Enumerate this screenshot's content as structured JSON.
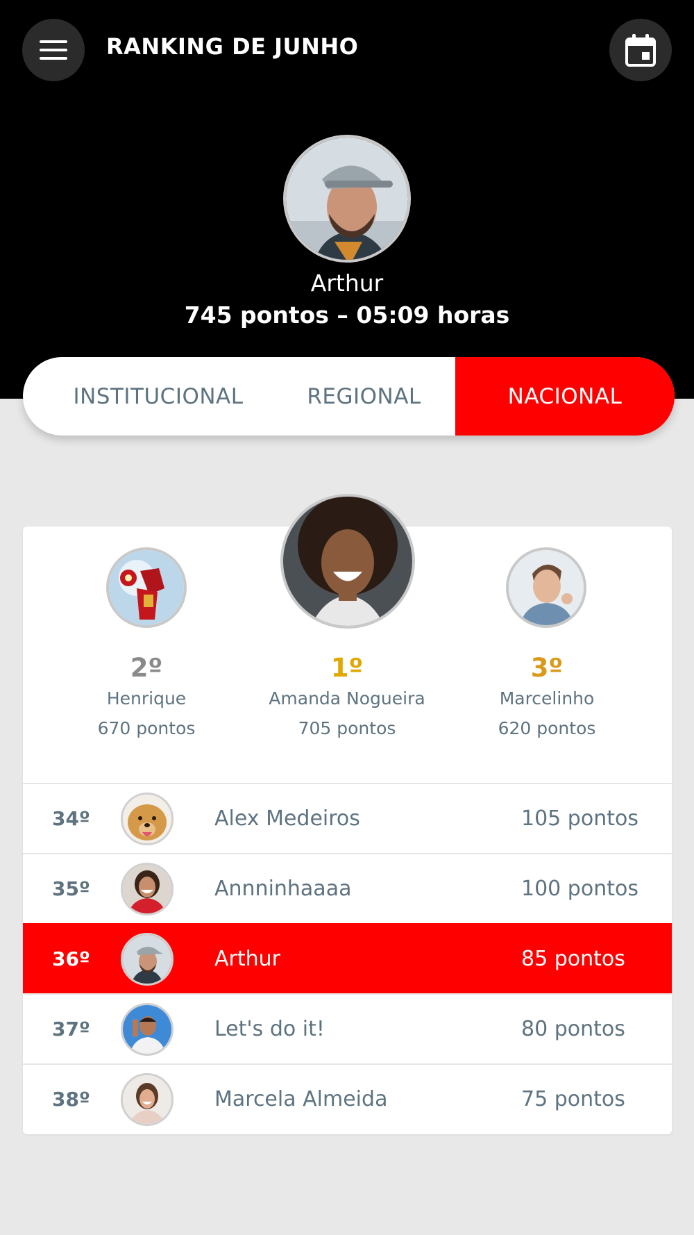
{
  "header": {
    "title": "RANKING DE JUNHO",
    "menu_icon": "hamburger-menu-icon",
    "calendar_icon": "calendar-icon"
  },
  "current_user": {
    "name": "Arthur",
    "stats": "745 pontos – 05:09 horas"
  },
  "tabs": [
    {
      "label": "INSTITUCIONAL",
      "active": false
    },
    {
      "label": "REGIONAL",
      "active": false
    },
    {
      "label": "NACIONAL",
      "active": true
    }
  ],
  "podium": {
    "first": {
      "rank": "1º",
      "name": "Amanda Nogueira",
      "points": "705 pontos"
    },
    "second": {
      "rank": "2º",
      "name": "Henrique",
      "points": "670 pontos"
    },
    "third": {
      "rank": "3º",
      "name": "Marcelinho",
      "points": "620 pontos"
    }
  },
  "ranking": [
    {
      "rank": "34º",
      "name": "Alex Medeiros",
      "points": "105 pontos",
      "highlight": false
    },
    {
      "rank": "35º",
      "name": "Annninhaaaa",
      "points": "100 pontos",
      "highlight": false
    },
    {
      "rank": "36º",
      "name": "Arthur",
      "points": "85 pontos",
      "highlight": true
    },
    {
      "rank": "37º",
      "name": "Let's do it!",
      "points": "80 pontos",
      "highlight": false
    },
    {
      "rank": "38º",
      "name": "Marcela Almeida",
      "points": "75 pontos",
      "highlight": false
    }
  ],
  "colors": {
    "accent": "#ff0000",
    "gold": "#e0a800",
    "silver": "#8a8a8a",
    "bronze": "#d99a1c",
    "text_muted": "#5e7380"
  }
}
